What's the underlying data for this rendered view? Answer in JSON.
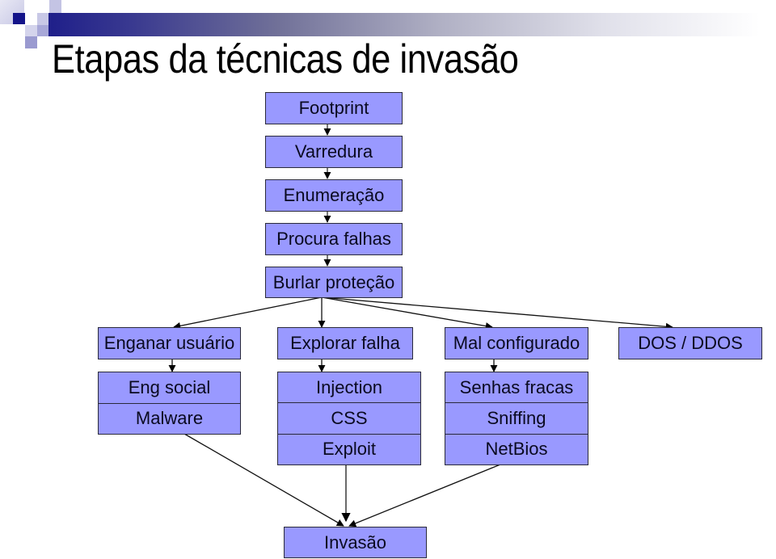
{
  "slide": {
    "title": "Etapas da técnicas de invasão",
    "colors": {
      "box_fill": "#9999ff",
      "box_border": "#2a2a3a",
      "header_dark": "#1f1f8a",
      "text": "#000000"
    }
  },
  "flow": {
    "main_chain": [
      "Footprint",
      "Varredura",
      "Enumeração",
      "Procura falhas",
      "Burlar proteção"
    ],
    "branches": [
      {
        "label": "Enganar usuário",
        "items": [
          "Eng social",
          "Malware"
        ]
      },
      {
        "label": "Explorar falha",
        "items": [
          "Injection",
          "CSS",
          "Exploit"
        ]
      },
      {
        "label": "Mal configurado",
        "items": [
          "Senhas fracas",
          "Sniffing",
          "NetBios"
        ]
      },
      {
        "label": "DOS / DDOS",
        "items": []
      }
    ],
    "final": "Invasão"
  }
}
